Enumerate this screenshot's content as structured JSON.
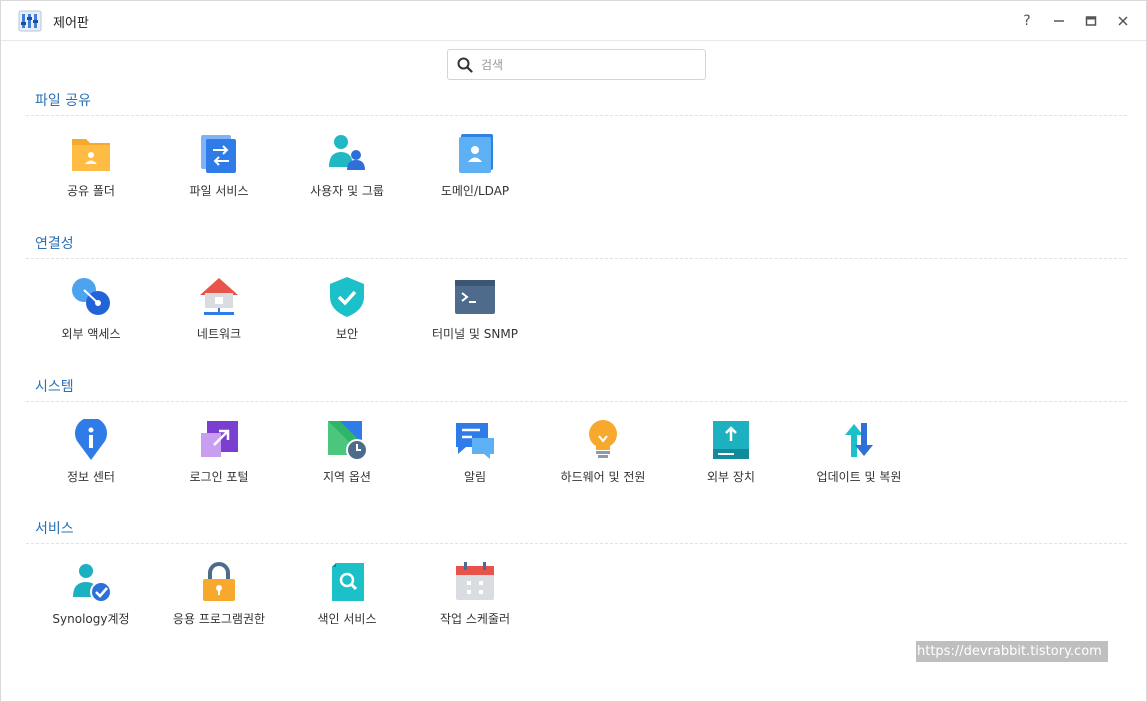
{
  "window": {
    "title": "제어판",
    "controls": {
      "help": "?",
      "minimize": "—",
      "maximize": "□",
      "close": "✕"
    }
  },
  "search": {
    "placeholder": "검색",
    "value": ""
  },
  "sections": [
    {
      "title": "파일 공유",
      "items": [
        {
          "label": "공유 폴더",
          "icon": "shared-folder-icon"
        },
        {
          "label": "파일 서비스",
          "icon": "file-services-icon"
        },
        {
          "label": "사용자 및 그룹",
          "icon": "user-group-icon"
        },
        {
          "label": "도메인/LDAP",
          "icon": "domain-ldap-icon"
        }
      ]
    },
    {
      "title": "연결성",
      "items": [
        {
          "label": "외부 액세스",
          "icon": "external-access-icon"
        },
        {
          "label": "네트워크",
          "icon": "network-icon"
        },
        {
          "label": "보안",
          "icon": "security-shield-icon"
        },
        {
          "label": "터미널 및 SNMP",
          "icon": "terminal-icon"
        }
      ]
    },
    {
      "title": "시스템",
      "items": [
        {
          "label": "정보 센터",
          "icon": "info-center-icon"
        },
        {
          "label": "로그인 포털",
          "icon": "login-portal-icon"
        },
        {
          "label": "지역 옵션",
          "icon": "regional-options-icon"
        },
        {
          "label": "알림",
          "icon": "notification-icon"
        },
        {
          "label": "하드웨어 및 전원",
          "icon": "hardware-power-icon"
        },
        {
          "label": "외부 장치",
          "icon": "external-devices-icon"
        },
        {
          "label": "업데이트 및 복원",
          "icon": "update-restore-icon"
        }
      ]
    },
    {
      "title": "서비스",
      "items": [
        {
          "label": "Synology계정",
          "icon": "synology-account-icon"
        },
        {
          "label": "응용 프로그램권한",
          "icon": "app-privileges-icon"
        },
        {
          "label": "색인 서비스",
          "icon": "indexing-service-icon"
        },
        {
          "label": "작업 스케줄러",
          "icon": "task-scheduler-icon"
        }
      ]
    }
  ],
  "watermark": "https://devrabbit.tistory.com"
}
